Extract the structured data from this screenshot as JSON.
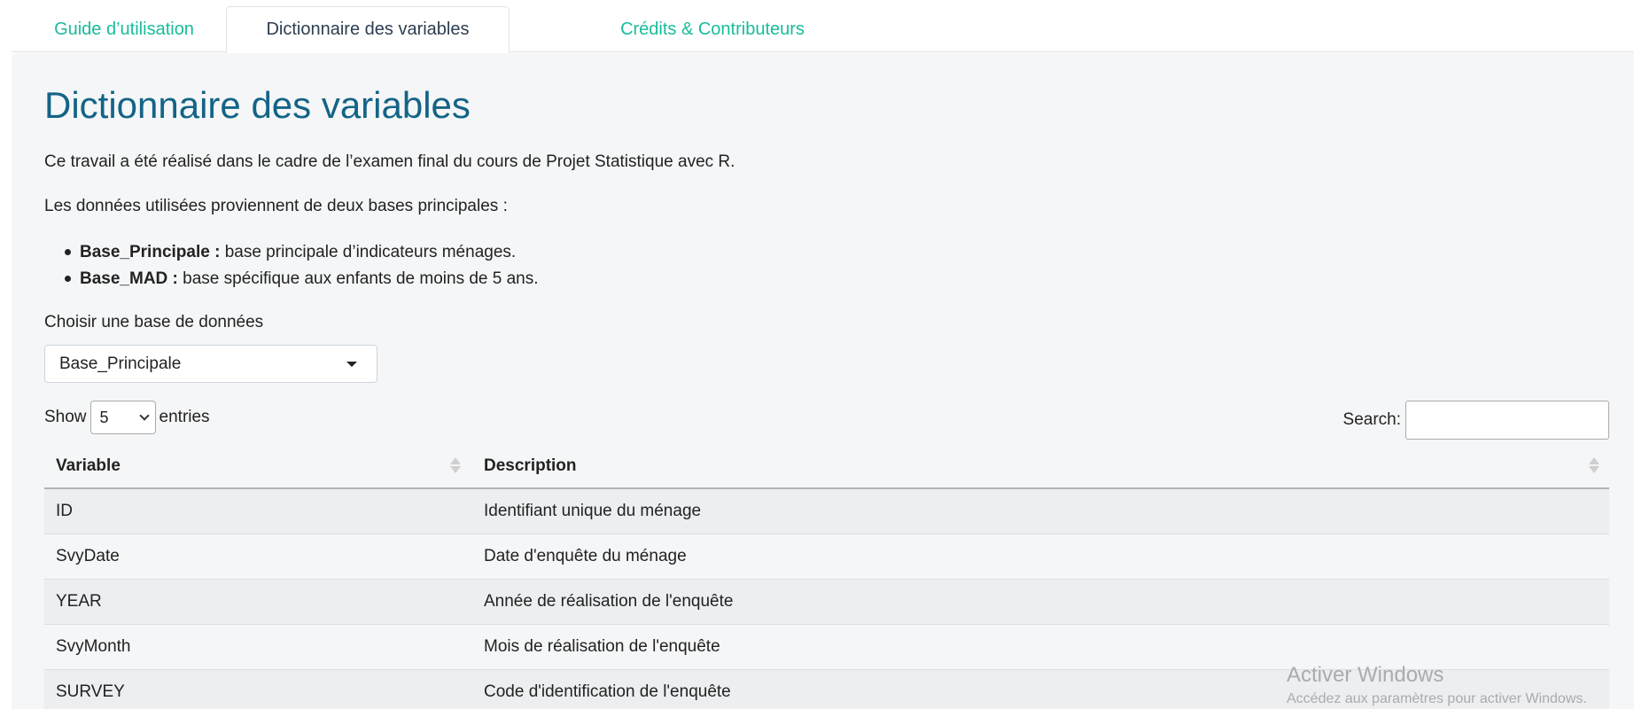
{
  "tabs": [
    {
      "label": "Guide d’utilisation"
    },
    {
      "label": "Dictionnaire des variables"
    },
    {
      "label": "Crédits & Contributeurs"
    }
  ],
  "main": {
    "title": "Dictionnaire des variables",
    "intro": "Ce travail a été réalisé dans le cadre de l’examen final du cours de Projet Statistique avec R.",
    "sources_intro": "Les données utilisées proviennent de deux bases principales :",
    "bases": [
      {
        "name": "Base_Principale :",
        "description": " base principale d’indicateurs ménages."
      },
      {
        "name": "Base_MAD :",
        "description": " base spécifique aux enfants de moins de 5 ans."
      }
    ],
    "select_label": "Choisir une base de données",
    "select_value": "Base_Principale"
  },
  "table_controls": {
    "show_label": "Show",
    "page_length": "5",
    "entries_label": "entries",
    "search_label": "Search:"
  },
  "table": {
    "headers": [
      "Variable",
      "Description"
    ],
    "rows": [
      [
        "ID",
        "Identifiant unique du ménage"
      ],
      [
        "SvyDate",
        "Date d'enquête du ménage"
      ],
      [
        "YEAR",
        "Année de réalisation de l'enquête"
      ],
      [
        "SvyMonth",
        "Mois de réalisation de l'enquête"
      ],
      [
        "SURVEY",
        "Code d'identification de l'enquête"
      ]
    ]
  },
  "watermark": {
    "title": "Activer Windows",
    "subtitle": "Accédez aux paramètres pour activer Windows."
  },
  "colors": {
    "accent": "#18bc9c",
    "title": "#136487",
    "panel": "#f5f6f7",
    "row_stripe": "#eceef0"
  }
}
